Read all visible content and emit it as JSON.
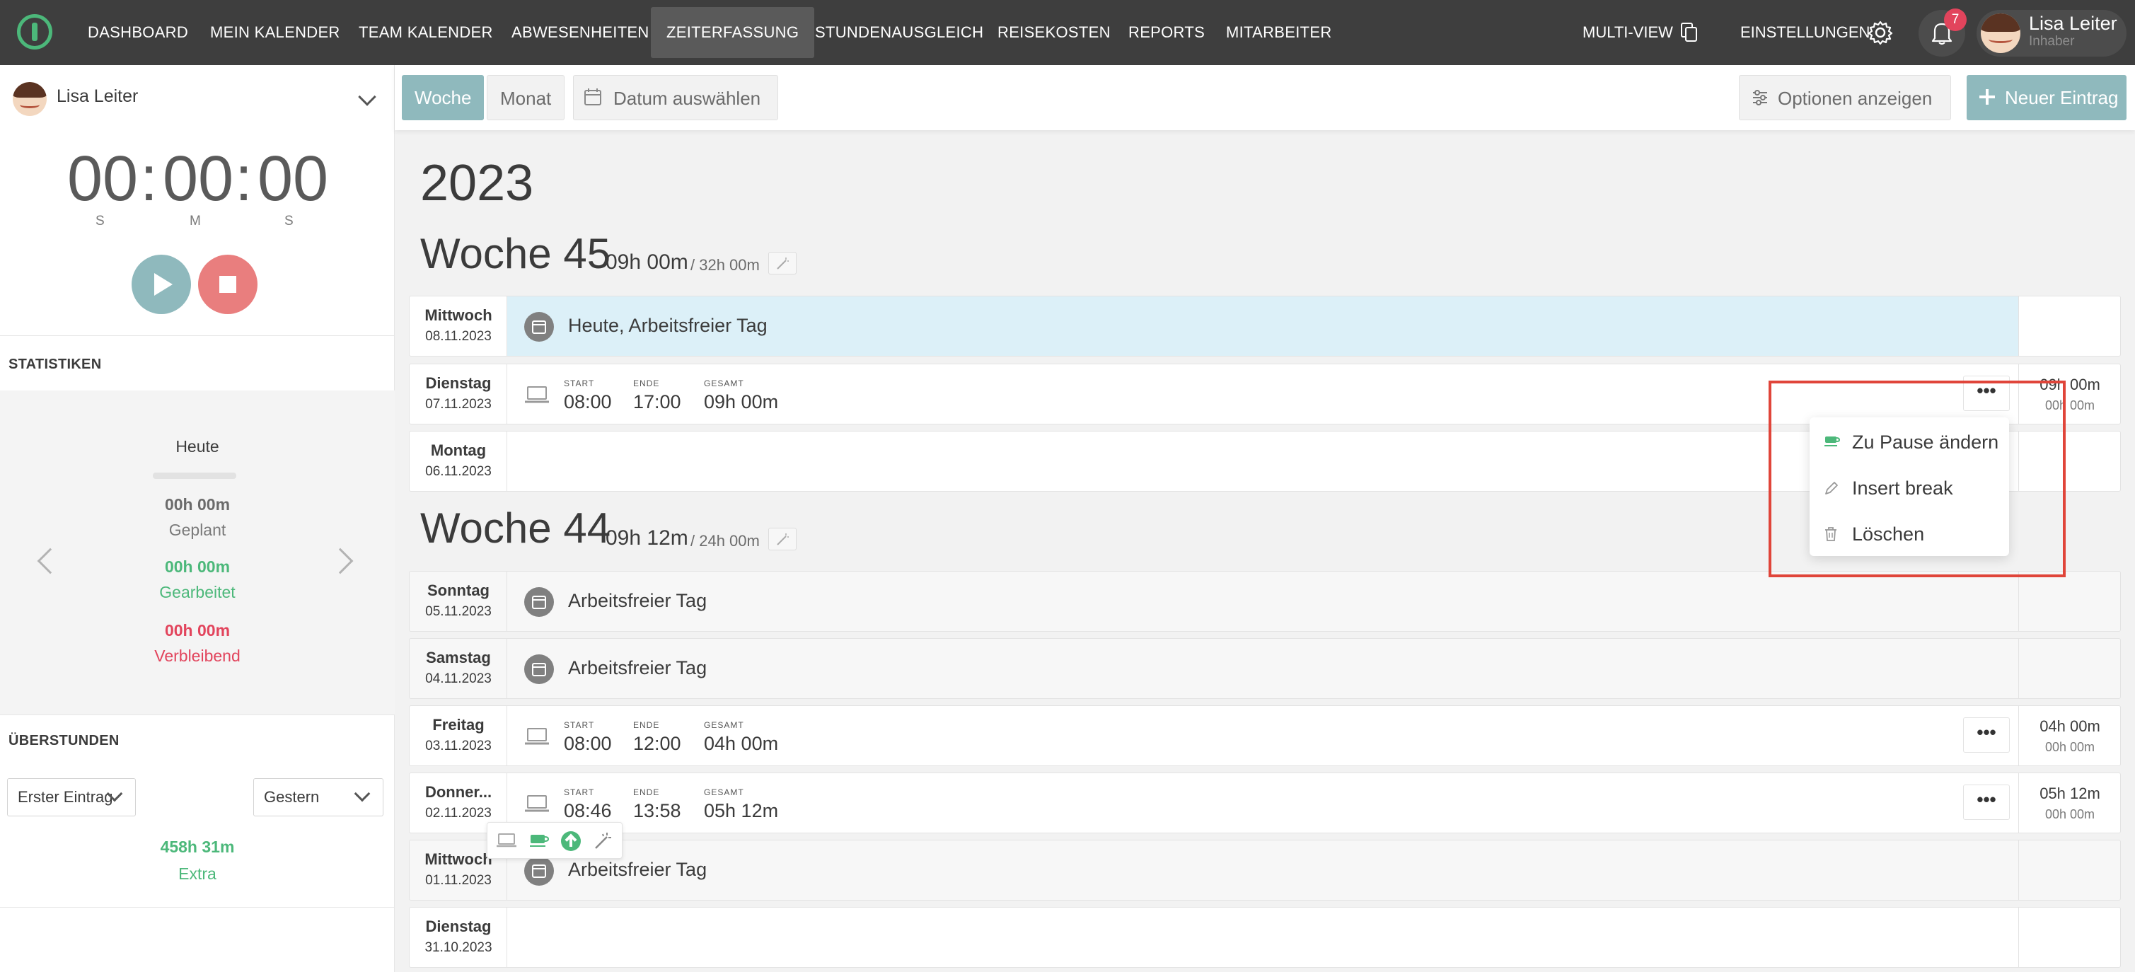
{
  "nav": {
    "items": [
      "DASHBOARD",
      "MEIN KALENDER",
      "TEAM KALENDER",
      "ABWESENHEITEN",
      "ZEITERFASSUNG",
      "STUNDENAUSGLEICH",
      "REISEKOSTEN",
      "REPORTS",
      "MITARBEITER"
    ],
    "active": "ZEITERFASSUNG",
    "multiview": "MULTI-VIEW",
    "settings": "EINSTELLUNGEN",
    "notification_count": "7",
    "user_name": "Lisa Leiter",
    "user_role": "Inhaber"
  },
  "sidebar": {
    "user_name": "Lisa Leiter",
    "timer": {
      "hours": "00",
      "minutes": "00",
      "seconds": "00",
      "separator": ":",
      "h_label": "S",
      "m_label": "M",
      "s_label": "S"
    },
    "stats_heading": "STATISTIKEN",
    "stats": {
      "period": "Heute",
      "planned_value": "00h 00m",
      "planned_label": "Geplant",
      "worked_value": "00h 00m",
      "worked_label": "Gearbeitet",
      "remaining_value": "00h 00m",
      "remaining_label": "Verbleibend"
    },
    "overtime_heading": "ÜBERSTUNDEN",
    "overtime": {
      "from_select": "Erster Eintrag",
      "to_select": "Gestern",
      "value": "458h 31m",
      "label": "Extra"
    }
  },
  "toolbar": {
    "week": "Woche",
    "month": "Monat",
    "date_picker": "Datum auswählen",
    "options": "Optionen anzeigen",
    "new_entry": "Neuer Eintrag"
  },
  "timesheet": {
    "year": "2023",
    "week45": {
      "title": "Woche 45",
      "hours": "09h 00m",
      "target": "/ 32h 00m"
    },
    "week44": {
      "title": "Woche 44",
      "hours": "09h 12m",
      "target": "/ 24h 00m"
    },
    "labels": {
      "start": "START",
      "end": "ENDE",
      "total": "GESAMT"
    },
    "days": [
      {
        "name": "Mittwoch",
        "date": "08.11.2023",
        "text": "Heute, Arbeitsfreier Tag"
      },
      {
        "name": "Dienstag",
        "date": "07.11.2023",
        "start": "08:00",
        "end": "17:00",
        "total": "09h 00m",
        "day_total": "09h 00m",
        "day_sub": "00h 00m"
      },
      {
        "name": "Montag",
        "date": "06.11.2023"
      },
      {
        "name": "Sonntag",
        "date": "05.11.2023",
        "text": "Arbeitsfreier Tag"
      },
      {
        "name": "Samstag",
        "date": "04.11.2023",
        "text": "Arbeitsfreier Tag"
      },
      {
        "name": "Freitag",
        "date": "03.11.2023",
        "start": "08:00",
        "end": "12:00",
        "total": "04h 00m",
        "day_total": "04h 00m",
        "day_sub": "00h 00m"
      },
      {
        "name": "Donner...",
        "date": "02.11.2023",
        "start": "08:46",
        "end": "13:58",
        "total": "05h 12m",
        "day_total": "05h 12m",
        "day_sub": "00h 00m"
      },
      {
        "name": "Mittwoch",
        "date": "01.11.2023",
        "text": "Arbeitsfreier Tag"
      },
      {
        "name": "Dienstag",
        "date": "31.10.2023"
      }
    ],
    "more_button": "•••"
  },
  "dropdown": {
    "items": [
      "Zu Pause ändern",
      "Insert break",
      "Löschen"
    ]
  },
  "colors": {
    "topbar": "#3e3e3e",
    "accent_teal": "#8fb9bd",
    "green": "#4cb87a",
    "red": "#e2445c",
    "today_row": "#dcf0f8",
    "highlight": "#e0453a"
  }
}
